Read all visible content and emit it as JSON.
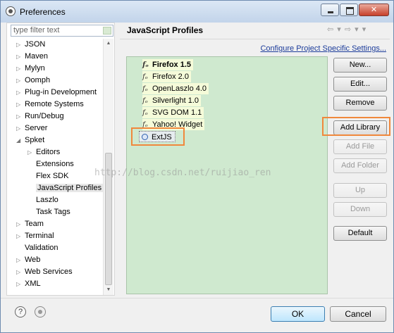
{
  "window": {
    "title": "Preferences"
  },
  "filter": {
    "placeholder": "type filter text"
  },
  "tree": {
    "items": [
      {
        "label": "JSON",
        "twisty": "▷"
      },
      {
        "label": "Maven",
        "twisty": "▷"
      },
      {
        "label": "Mylyn",
        "twisty": "▷"
      },
      {
        "label": "Oomph",
        "twisty": "▷"
      },
      {
        "label": "Plug-in Development",
        "twisty": "▷"
      },
      {
        "label": "Remote Systems",
        "twisty": "▷"
      },
      {
        "label": "Run/Debug",
        "twisty": "▷"
      },
      {
        "label": "Server",
        "twisty": "▷"
      },
      {
        "label": "Spket",
        "twisty": "◢"
      },
      {
        "label": "Editors",
        "twisty": "▷"
      },
      {
        "label": "Extensions",
        "twisty": ""
      },
      {
        "label": "Flex SDK",
        "twisty": ""
      },
      {
        "label": "JavaScript Profiles",
        "twisty": ""
      },
      {
        "label": "Laszlo",
        "twisty": ""
      },
      {
        "label": "Task Tags",
        "twisty": ""
      },
      {
        "label": "Team",
        "twisty": "▷"
      },
      {
        "label": "Terminal",
        "twisty": "▷"
      },
      {
        "label": "Validation",
        "twisty": ""
      },
      {
        "label": "Web",
        "twisty": "▷"
      },
      {
        "label": "Web Services",
        "twisty": "▷"
      },
      {
        "label": "XML",
        "twisty": "▷"
      }
    ]
  },
  "page": {
    "title": "JavaScript Profiles",
    "config_link": "Configure Project Specific Settings..."
  },
  "profiles": [
    {
      "label": "Firefox 1.5",
      "icon": "fx-icon"
    },
    {
      "label": "Firefox 2.0",
      "icon": "fx-icon"
    },
    {
      "label": "OpenLaszlo 4.0",
      "icon": "fx-icon"
    },
    {
      "label": "Silverlight 1.0",
      "icon": "fx-icon"
    },
    {
      "label": "SVG DOM 1.1",
      "icon": "fx-icon"
    },
    {
      "label": "Yahoo! Widget",
      "icon": "fx-icon"
    }
  ],
  "library": {
    "label": "ExtJS",
    "icon": "library-icon"
  },
  "buttons": {
    "new": "New...",
    "edit": "Edit...",
    "remove": "Remove",
    "add_library": "Add Library",
    "add_file": "Add File",
    "add_folder": "Add Folder",
    "up": "Up",
    "down": "Down",
    "default": "Default",
    "ok": "OK",
    "cancel": "Cancel"
  },
  "watermark": "http://blog.csdn.net/ruijiao_ren",
  "colors": {
    "highlight": "#f0883c",
    "list_background": "#cfe9cf",
    "link": "#1c3c9a"
  }
}
